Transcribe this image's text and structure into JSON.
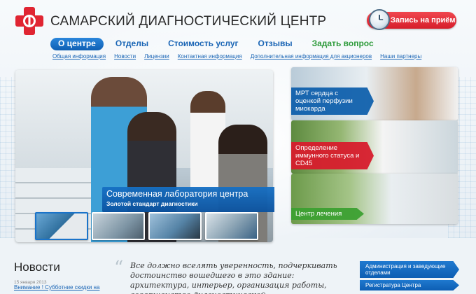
{
  "header": {
    "title": "САМАРСКИЙ ДИАГНОСТИЧЕСКИЙ ЦЕНТР",
    "appointment_button": "Запись на приём"
  },
  "nav": {
    "items": [
      {
        "label": "О центре",
        "active": true
      },
      {
        "label": "Отделы",
        "active": false
      },
      {
        "label": "Стоимость услуг",
        "active": false
      },
      {
        "label": "Отзывы",
        "active": false
      },
      {
        "label": "Задать вопрос",
        "active": false
      }
    ]
  },
  "subnav": {
    "items": [
      {
        "label": "Общая информация"
      },
      {
        "label": "Новости"
      },
      {
        "label": "Лицензии"
      },
      {
        "label": "Контактная информация"
      },
      {
        "label": "Дополнительная информация для акционеров"
      },
      {
        "label": "Наши партнеры"
      }
    ]
  },
  "hero": {
    "caption_title": "Современная лаборатория центра",
    "caption_subtitle": "Золотой стандарт диагностики"
  },
  "promos": [
    {
      "label": "МРТ сердца с оценкой перфузии миокарда"
    },
    {
      "label": "Определение иммунного статуса и CD45"
    },
    {
      "label": "Центр лечения"
    }
  ],
  "news": {
    "title": "Новости",
    "date": "15 января 2013",
    "link": "Внимание ! Субботние скидки на"
  },
  "quote": {
    "text": "Все должно вселять уверенность, подчеркивать достоинство вошедшего в это здание: архитектура, интерьер, организация работы, совершенство диагностической"
  },
  "side_menu": {
    "items": [
      {
        "label": "Администрация и заведующие отделами"
      },
      {
        "label": "Регистратура Центра"
      }
    ]
  },
  "colors": {
    "brand_blue": "#1a65b5",
    "accent_red": "#d61d2a",
    "accent_green": "#2e9b3b"
  }
}
